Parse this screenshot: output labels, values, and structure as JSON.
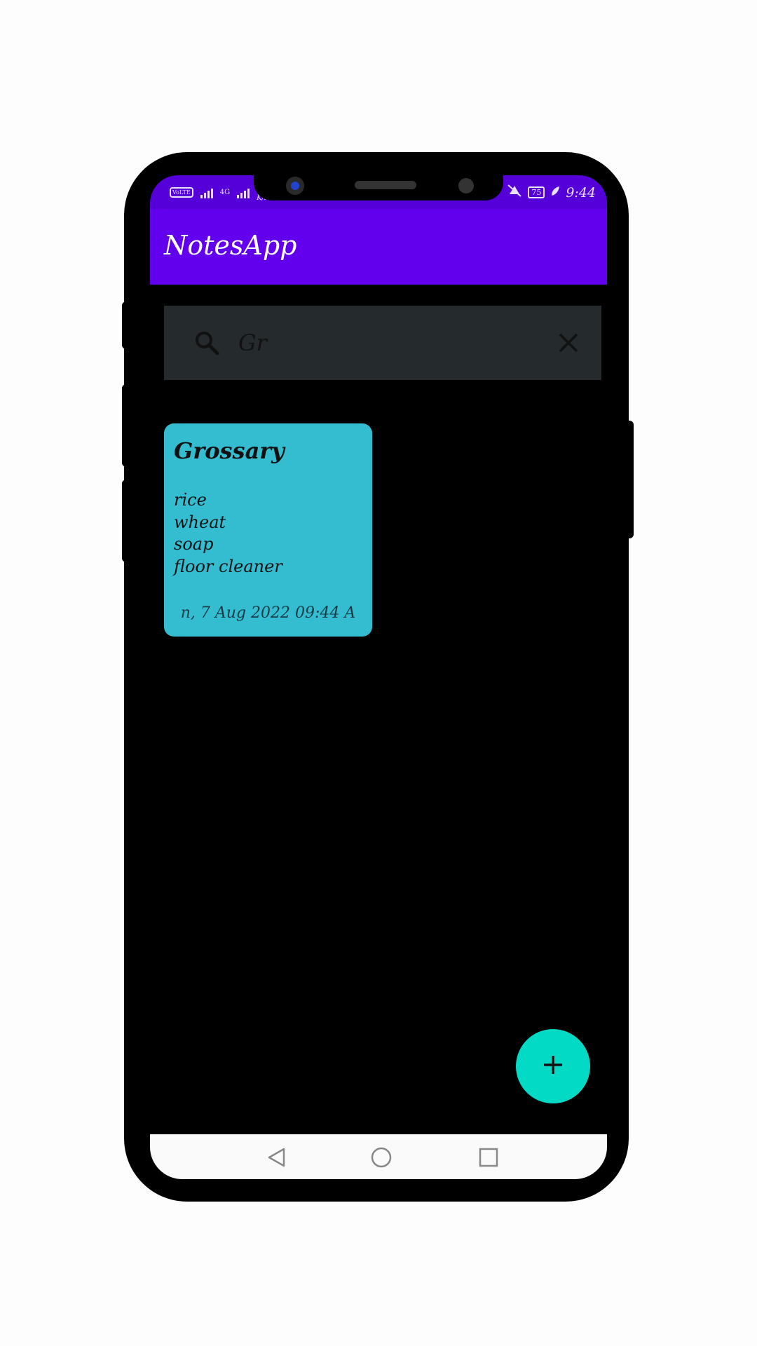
{
  "status_bar": {
    "volte": "VoLTE",
    "network_type": "4G",
    "speed_unit": "K/s",
    "battery": "75",
    "time": "9:44"
  },
  "app_bar": {
    "title": "NotesApp"
  },
  "search": {
    "query": "Gr"
  },
  "notes": [
    {
      "title": "Grossary",
      "lines": [
        "rice",
        "wheat",
        "soap",
        "floor cleaner"
      ],
      "date": "n, 7 Aug 2022 09:44 A"
    }
  ],
  "fab": {
    "icon": "plus-icon"
  },
  "colors": {
    "status_bar": "#5500d9",
    "app_bar": "#6200ee",
    "note_card": "#34bdd0",
    "fab": "#03dac5",
    "background": "#000000"
  }
}
